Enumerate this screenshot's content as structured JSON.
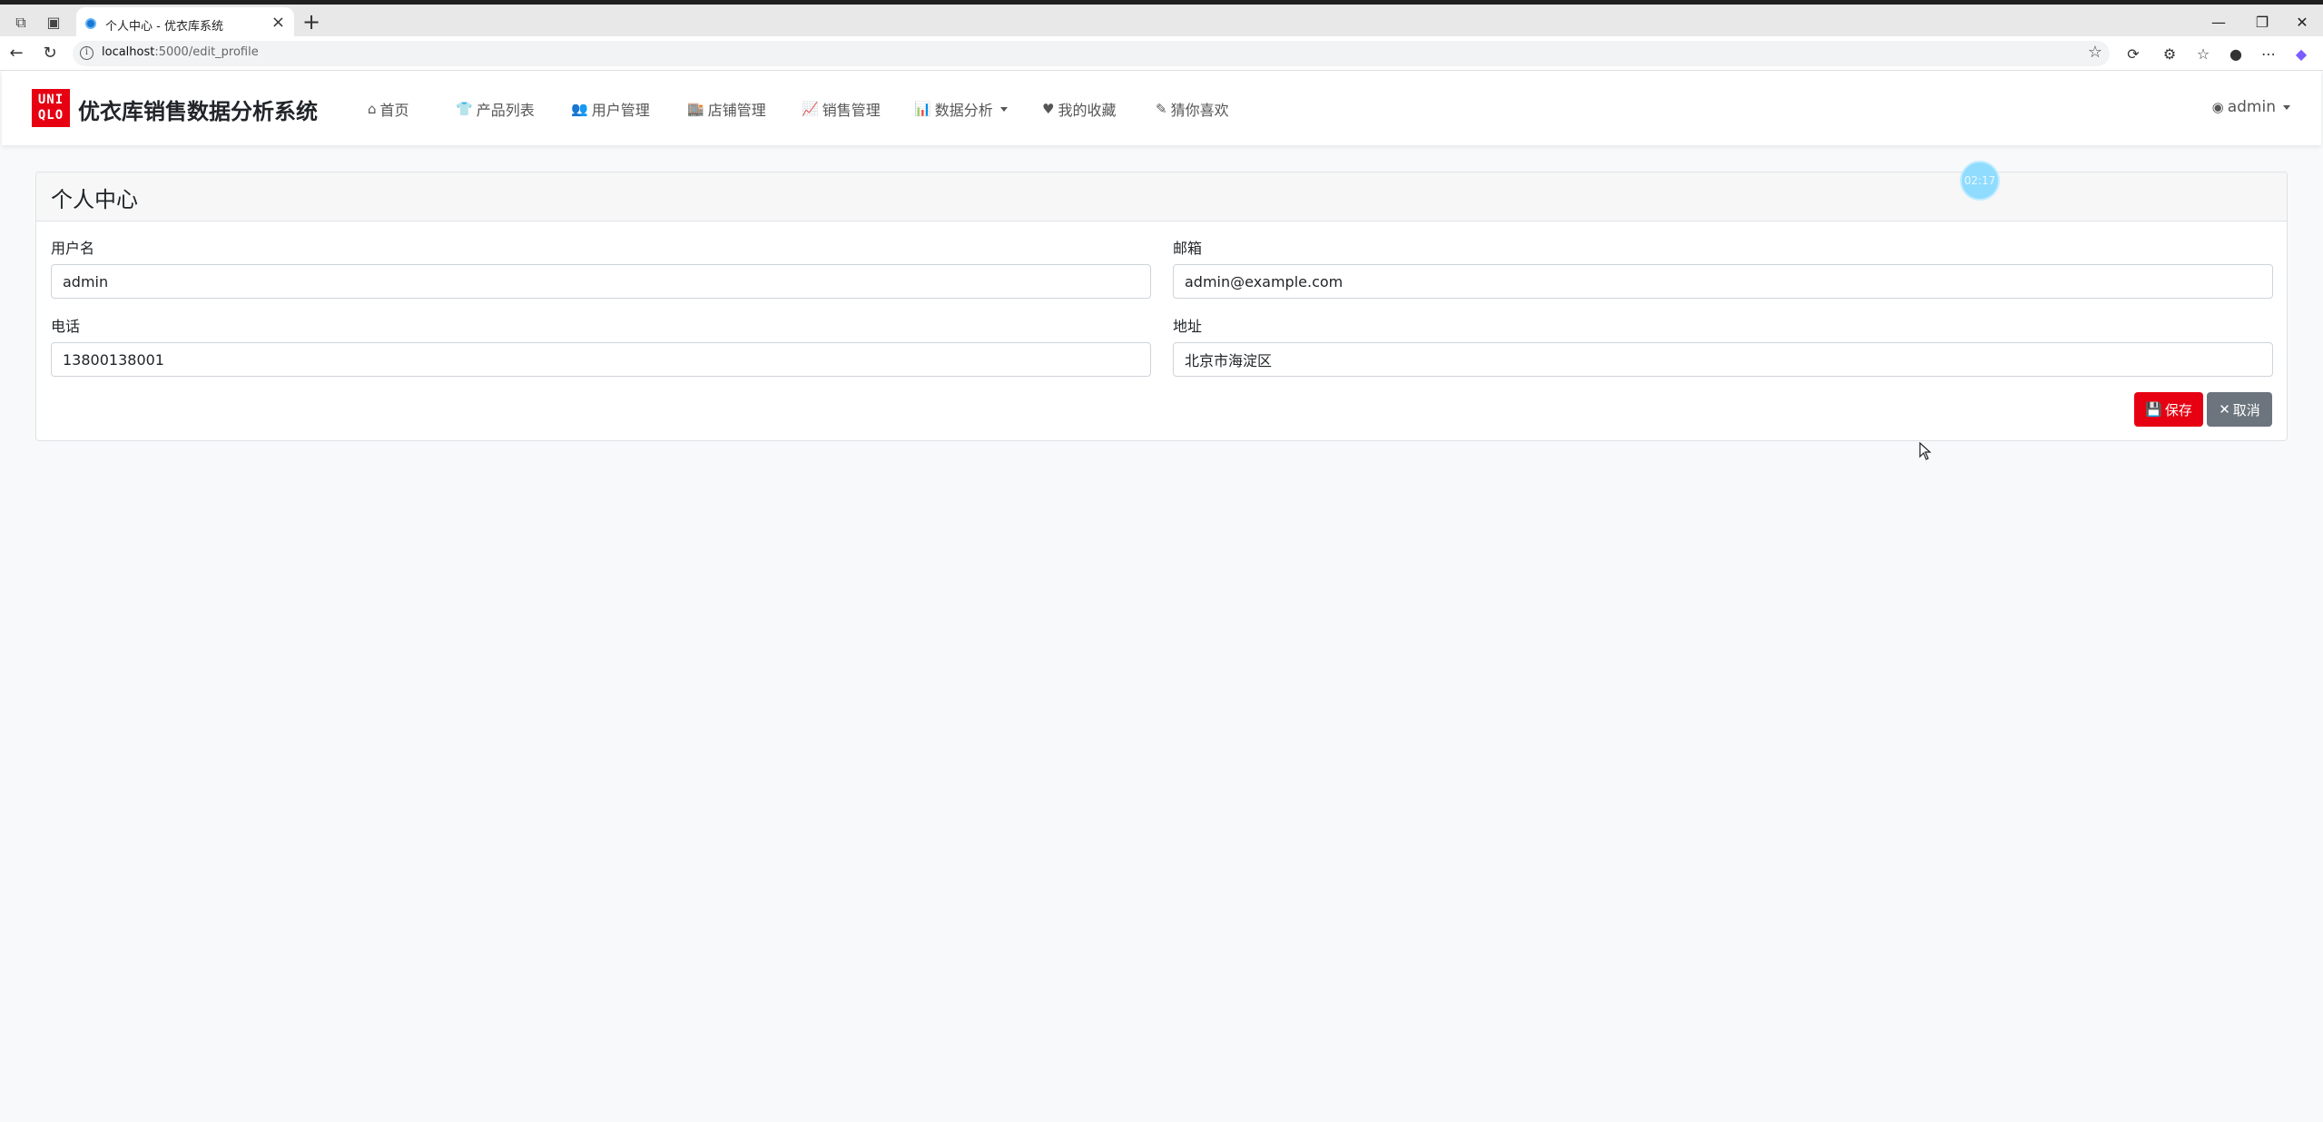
{
  "browser": {
    "tab_title": "个人中心 - 优衣库系统",
    "url_host": "localhost",
    "url_rest": ":5000/edit_profile"
  },
  "navbar": {
    "logo_line1": "UNI",
    "logo_line2": "QLO",
    "brand": "优衣库销售数据分析系统",
    "items": [
      {
        "label": "首页",
        "icon": "home-icon"
      },
      {
        "label": "产品列表",
        "icon": "tshirt-icon"
      },
      {
        "label": "用户管理",
        "icon": "users-icon"
      },
      {
        "label": "店铺管理",
        "icon": "store-icon"
      },
      {
        "label": "销售管理",
        "icon": "line-chart-icon"
      },
      {
        "label": "数据分析",
        "icon": "bar-chart-icon"
      },
      {
        "label": "我的收藏",
        "icon": "heart-icon"
      },
      {
        "label": "猜你喜欢",
        "icon": "pencil-icon"
      }
    ],
    "user": "admin"
  },
  "profile": {
    "title": "个人中心",
    "username_label": "用户名",
    "username_value": "admin",
    "email_label": "邮箱",
    "email_value": "admin@example.com",
    "phone_label": "电话",
    "phone_value": "13800138001",
    "address_label": "地址",
    "address_value": "北京市海淀区",
    "save_label": "保存",
    "cancel_label": "取消"
  },
  "timer": "02:17"
}
